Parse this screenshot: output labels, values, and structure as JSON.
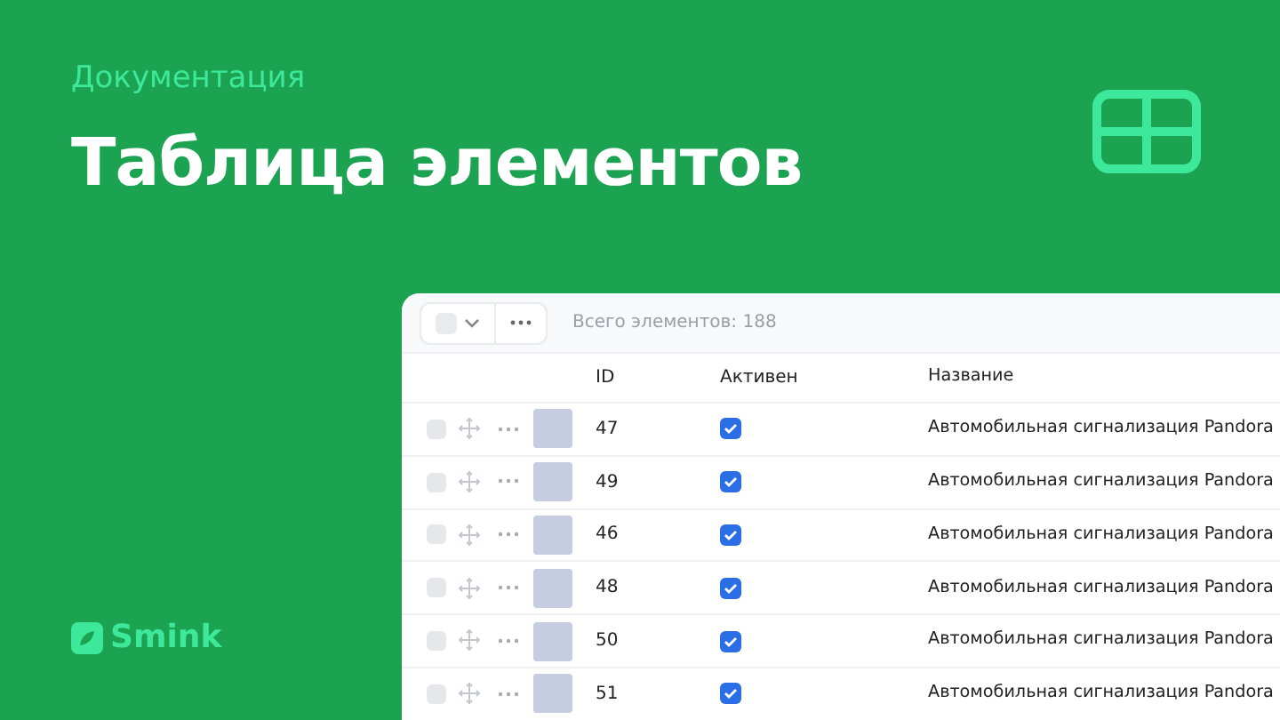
{
  "header": {
    "caption": "Документация",
    "title": "Таблица элементов"
  },
  "logo": {
    "text": "Smink"
  },
  "table": {
    "select_all": {
      "checked": false
    },
    "total": "Всего элементов: 188",
    "columns": [
      "ID",
      "Активен",
      "Название"
    ],
    "rows": [
      {
        "selected": false,
        "id": "47",
        "active": true,
        "name": "Автомобильная сигнализация Pandora"
      },
      {
        "selected": false,
        "id": "49",
        "active": true,
        "name": "Автомобильная сигнализация Pandora"
      },
      {
        "selected": false,
        "id": "46",
        "active": true,
        "name": "Автомобильная сигнализация Pandora"
      },
      {
        "selected": false,
        "id": "48",
        "active": true,
        "name": "Автомобильная сигнализация Pandora"
      },
      {
        "selected": false,
        "id": "50",
        "active": true,
        "name": "Автомобильная сигнализация Pandora"
      },
      {
        "selected": false,
        "id": "51",
        "active": true,
        "name": "Автомобильная сигнализация Pandora"
      }
    ]
  }
}
